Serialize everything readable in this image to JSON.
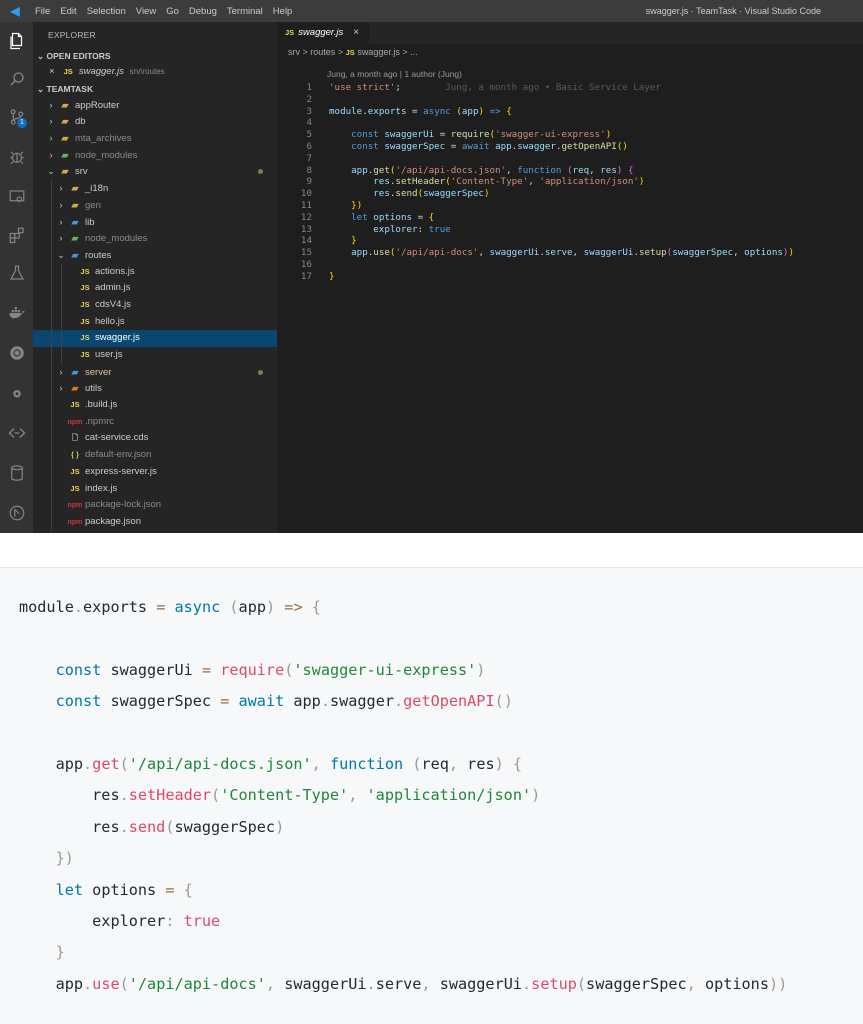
{
  "titlebar": {
    "menu": [
      "File",
      "Edit",
      "Selection",
      "View",
      "Go",
      "Debug",
      "Terminal",
      "Help"
    ],
    "window_title": "swagger.js · TeamTask · Visual Studio Code"
  },
  "activitybar": {
    "icons": [
      "files-icon",
      "search-icon",
      "source-control-icon",
      "debug-icon",
      "remote-explorer-icon",
      "extensions-icon",
      "test-flask-icon",
      "docker-icon",
      "kubernetes-icon",
      "cloud-icon",
      "api-icon",
      "database-icon",
      "deploy-icon"
    ],
    "source_control_badge": "1"
  },
  "sidebar": {
    "title": "EXPLORER",
    "open_editors_header": "OPEN EDITORS",
    "open_editor": {
      "close": "×",
      "badge": "JS",
      "name": "swagger.js",
      "path": "srv\\routes"
    },
    "project_header": "TEAMTASK",
    "tree": [
      {
        "label": "appRouter",
        "type": "folder",
        "depth": 0,
        "chevron": "›",
        "dim": false
      },
      {
        "label": "db",
        "type": "folder",
        "depth": 0,
        "chevron": "›",
        "dim": false
      },
      {
        "label": "mta_archives",
        "type": "folder",
        "depth": 0,
        "chevron": "›",
        "dim": true
      },
      {
        "label": "node_modules",
        "type": "folder-green",
        "depth": 0,
        "chevron": "›",
        "dim": true
      },
      {
        "label": "srv",
        "type": "folder",
        "depth": 0,
        "chevron": "⌄",
        "dim": false,
        "dot": true
      },
      {
        "label": "_i18n",
        "type": "folder",
        "depth": 1,
        "chevron": "›",
        "dim": false
      },
      {
        "label": "gen",
        "type": "folder",
        "depth": 1,
        "chevron": "›",
        "dim": true
      },
      {
        "label": "lib",
        "type": "folder-blue",
        "depth": 1,
        "chevron": "›",
        "dim": false
      },
      {
        "label": "node_modules",
        "type": "folder-green",
        "depth": 1,
        "chevron": "›",
        "dim": true
      },
      {
        "label": "routes",
        "type": "folder-blue",
        "depth": 1,
        "chevron": "⌄",
        "dim": false
      },
      {
        "label": "actions.js",
        "type": "js",
        "depth": 2,
        "chevron": "",
        "dim": false
      },
      {
        "label": "admin.js",
        "type": "js",
        "depth": 2,
        "chevron": "",
        "dim": false
      },
      {
        "label": "cdsV4.js",
        "type": "js",
        "depth": 2,
        "chevron": "",
        "dim": false
      },
      {
        "label": "hello.js",
        "type": "js",
        "depth": 2,
        "chevron": "",
        "dim": false
      },
      {
        "label": "swagger.js",
        "type": "js",
        "depth": 2,
        "chevron": "",
        "dim": false,
        "selected": true
      },
      {
        "label": "user.js",
        "type": "js",
        "depth": 2,
        "chevron": "",
        "dim": false
      },
      {
        "label": "server",
        "type": "folder-blue",
        "depth": 1,
        "chevron": "›",
        "dim": false,
        "dot": true,
        "color": "#e2c08d"
      },
      {
        "label": "utils",
        "type": "folder-orange",
        "depth": 1,
        "chevron": "›",
        "dim": false
      },
      {
        "label": ".build.js",
        "type": "js",
        "depth": 1,
        "chevron": "",
        "dim": false
      },
      {
        "label": ".npmrc",
        "type": "npm",
        "depth": 1,
        "chevron": "",
        "dim": true
      },
      {
        "label": "cat-service.cds",
        "type": "file",
        "depth": 1,
        "chevron": "",
        "dim": false
      },
      {
        "label": "default-env.json",
        "type": "json",
        "depth": 1,
        "chevron": "",
        "dim": true
      },
      {
        "label": "express-server.js",
        "type": "js",
        "depth": 1,
        "chevron": "",
        "dim": false
      },
      {
        "label": "index.js",
        "type": "js",
        "depth": 1,
        "chevron": "",
        "dim": false
      },
      {
        "label": "package-lock.json",
        "type": "npm",
        "depth": 1,
        "chevron": "",
        "dim": true
      },
      {
        "label": "package.json",
        "type": "npm",
        "depth": 1,
        "chevron": "",
        "dim": false
      }
    ],
    "type_glyphs": {
      "js": "JS",
      "npm": "npm",
      "json": "{ }",
      "file": "🗋",
      "folder": "▰"
    }
  },
  "editor": {
    "tab": {
      "badge": "JS",
      "name": "swagger.js",
      "close": "×"
    },
    "breadcrumb": {
      "part1": "srv",
      "sep": ">",
      "part2": "routes",
      "badge": "JS",
      "part3": "swagger.js",
      "part4": "..."
    },
    "codelens": "Jung, a month ago | 1 author (Jung)",
    "blame": "Jung, a month ago • Basic Service Layer",
    "line_numbers": [
      "1",
      "2",
      "3",
      "4",
      "5",
      "6",
      "7",
      "8",
      "9",
      "10",
      "11",
      "12",
      "13",
      "14",
      "15",
      "16",
      "17"
    ]
  },
  "code_lines": [
    "'use strict';",
    "",
    "module.exports = async (app) => {",
    "",
    "    const swaggerUi = require('swagger-ui-express')",
    "    const swaggerSpec = await app.swagger.getOpenAPI()",
    "",
    "    app.get('/api/api-docs.json', function (req, res) {",
    "        res.setHeader('Content-Type', 'application/json')",
    "        res.send(swaggerSpec)",
    "    })",
    "    let options = {",
    "        explorer: true",
    "    }",
    "    app.use('/api/api-docs', swaggerUi.serve, swaggerUi.setup(swaggerSpec, options))",
    "",
    "}"
  ],
  "colors": {
    "vscode_bg": "#1e1e1e",
    "sidebar_bg": "#252526",
    "activity_bg": "#333333",
    "selection": "#094771",
    "snippet_bg": "#f6f8fa"
  }
}
